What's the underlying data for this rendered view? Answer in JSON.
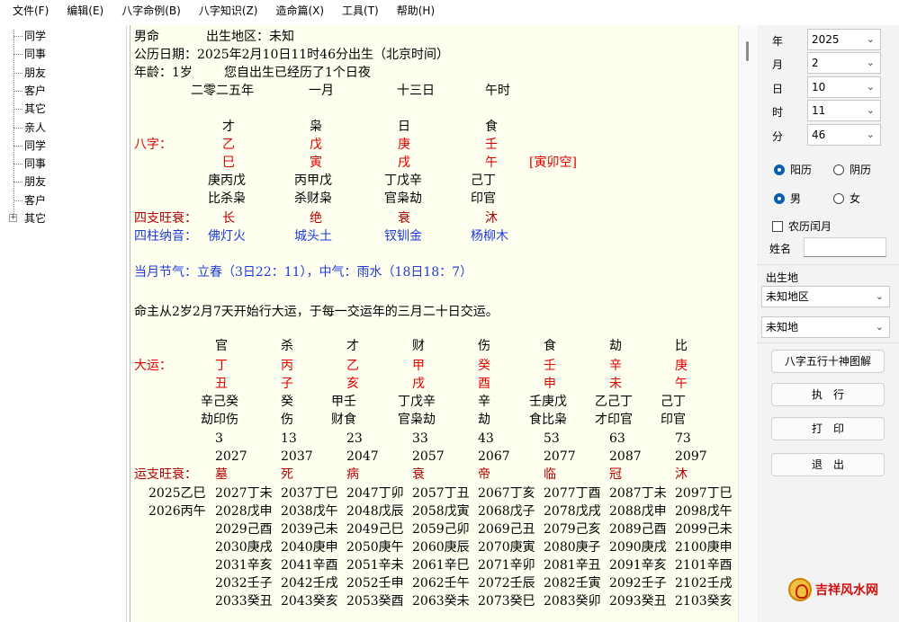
{
  "menu": [
    "文件(F)",
    "编辑(E)",
    "八字命例(B)",
    "八字知识(Z)",
    "造命篇(X)",
    "工具(T)",
    "帮助(H)"
  ],
  "tree": [
    "同学",
    "同事",
    "朋友",
    "客户",
    "其它",
    "亲人",
    "同学",
    "同事",
    "朋友",
    "客户",
    "其它"
  ],
  "doc": {
    "gender": "男命",
    "birthplace": "出生地区：未知",
    "gregorian": "公历日期：2025年2月10日11时46分出生（北京时间）",
    "age": "年龄：1岁",
    "age_note": "您自出生已经历了1个日夜",
    "lunar": [
      "二零二五年",
      "一月",
      "十三日",
      "午时"
    ],
    "stem_gods": [
      "才",
      "枭",
      "日",
      "食"
    ],
    "bazi_label": "八字：",
    "stems": [
      "乙",
      "戊",
      "庚",
      "壬"
    ],
    "branches": [
      "巳",
      "寅",
      "戌",
      "午"
    ],
    "kongwang": "[寅卯空]",
    "hidden_stems": [
      "庚丙戊",
      "丙甲戊",
      "丁戊辛",
      "己丁"
    ],
    "hidden_gods": [
      "比杀枭",
      "杀财枭",
      "官枭劫",
      "印官"
    ],
    "sizhi_label": "四支旺衰：",
    "sizhi": [
      "长",
      "绝",
      "衰",
      "沐"
    ],
    "nayin_label": "四柱纳音：",
    "nayin": [
      "佛灯火",
      "城头土",
      "钗钏金",
      "杨柳木"
    ],
    "jieqi": "当月节气：立春（3日22：11），中气：雨水（18日18：7）",
    "dayun_start": "命主从2岁2月7天开始行大运，于每一交运年的三月二十日交运。",
    "dayun_label": "大运：",
    "dy_gods": [
      "官",
      "杀",
      "才",
      "财",
      "伤",
      "食",
      "劫",
      "比"
    ],
    "dy_stems": [
      "丁",
      "丙",
      "乙",
      "甲",
      "癸",
      "壬",
      "辛",
      "庚"
    ],
    "dy_branches": [
      "丑",
      "子",
      "亥",
      "戌",
      "酉",
      "申",
      "未",
      "午"
    ],
    "dy_hidden": [
      "辛己癸",
      "癸",
      "甲壬",
      "丁戊辛",
      "辛",
      "壬庚戊",
      "乙己丁",
      "己丁"
    ],
    "dy_hidden_gods": [
      "劫印伤",
      "伤",
      "财食",
      "官枭劫",
      "劫",
      "食比枭",
      "才印官",
      "印官"
    ],
    "dy_ages": [
      "3",
      "13",
      "23",
      "33",
      "43",
      "53",
      "63",
      "73"
    ],
    "dy_years": [
      "2027",
      "2037",
      "2047",
      "2057",
      "2067",
      "2077",
      "2087",
      "2097"
    ],
    "yunzhi_label": "运支旺衰：",
    "yunzhi": [
      "墓",
      "死",
      "病",
      "衰",
      "帝",
      "临",
      "冠",
      "沐"
    ],
    "pre_years": [
      "2025乙巳",
      "2026丙午"
    ],
    "liunian": [
      [
        "2027丁未",
        "2037丁巳",
        "2047丁卯",
        "2057丁丑",
        "2067丁亥",
        "2077丁酉",
        "2087丁未",
        "2097丁巳"
      ],
      [
        "2028戊申",
        "2038戊午",
        "2048戊辰",
        "2058戊寅",
        "2068戊子",
        "2078戊戌",
        "2088戊申",
        "2098戊午"
      ],
      [
        "2029己酉",
        "2039己未",
        "2049己巳",
        "2059己卯",
        "2069己丑",
        "2079己亥",
        "2089己酉",
        "2099己未"
      ],
      [
        "2030庚戌",
        "2040庚申",
        "2050庚午",
        "2060庚辰",
        "2070庚寅",
        "2080庚子",
        "2090庚戌",
        "2100庚申"
      ],
      [
        "2031辛亥",
        "2041辛酉",
        "2051辛未",
        "2061辛巳",
        "2071辛卯",
        "2081辛丑",
        "2091辛亥",
        "2101辛酉"
      ],
      [
        "2032壬子",
        "2042壬戌",
        "2052壬申",
        "2062壬午",
        "2072壬辰",
        "2082壬寅",
        "2092壬子",
        "2102壬戌"
      ],
      [
        "2033癸丑",
        "2043癸亥",
        "2053癸酉",
        "2063癸未",
        "2073癸巳",
        "2083癸卯",
        "2093癸丑",
        "2103癸亥"
      ]
    ]
  },
  "panel": {
    "year_label": "年",
    "year": "2025",
    "month_label": "月",
    "month": "2",
    "day_label": "日",
    "day": "10",
    "hour_label": "时",
    "hour": "11",
    "minute_label": "分",
    "minute": "46",
    "solar": "阳历",
    "lunar": "阴历",
    "male": "男",
    "female": "女",
    "leap": "农历闰月",
    "name_label": "姓名",
    "birthplace_label": "出生地",
    "place1": "未知地区",
    "place2": "未知地",
    "btn_chart": "八字五行十神图解",
    "btn_run": "执　行",
    "btn_print": "打　印",
    "btn_exit": "退　出"
  },
  "logo_text": "吉祥风水网",
  "colors": {
    "red": "#e00000",
    "darkred": "#b00000",
    "blue": "#1f3bd8",
    "accent": "#0b5cad"
  }
}
